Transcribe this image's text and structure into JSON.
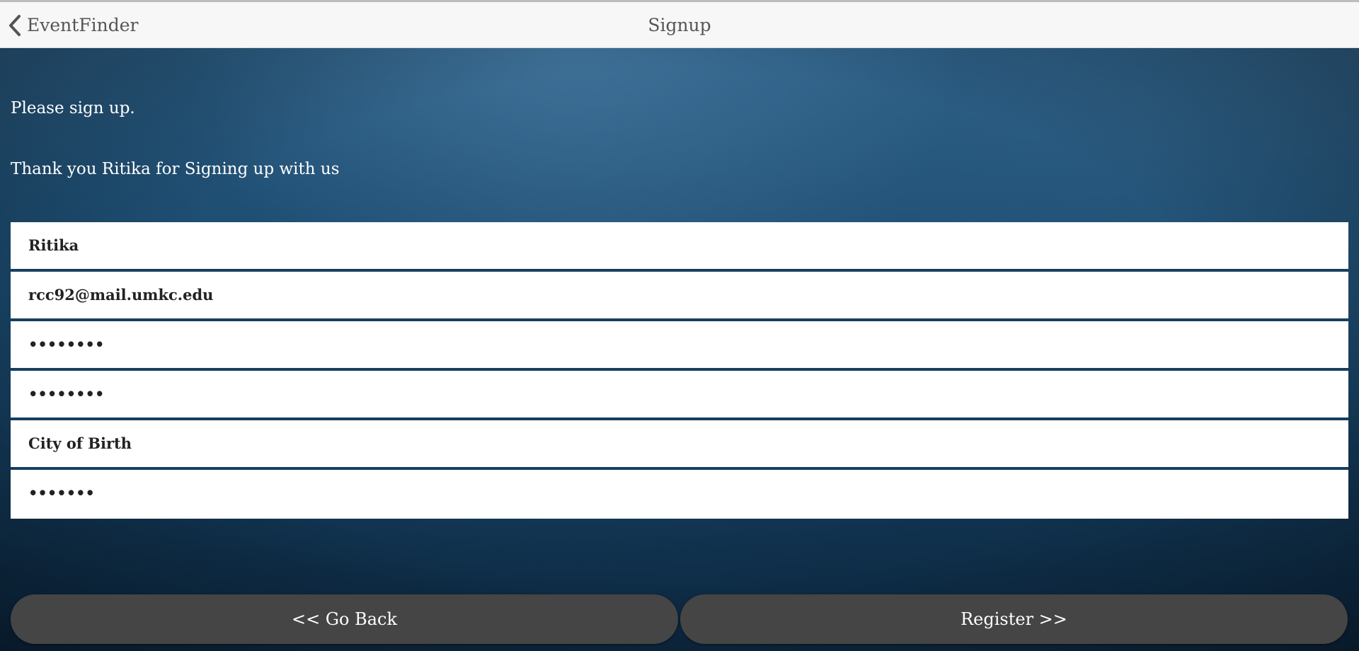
{
  "header": {
    "back_label": "EventFinder",
    "title": "Signup"
  },
  "messages": {
    "prompt": "Please sign up.",
    "thanks": "Thank you Ritika for Signing up with us"
  },
  "form": {
    "fields": [
      {
        "name": "name",
        "value": "Ritika",
        "type": "text"
      },
      {
        "name": "email",
        "value": "rcc92@mail.umkc.edu",
        "type": "email"
      },
      {
        "name": "password",
        "value": "••••••••",
        "type": "password"
      },
      {
        "name": "confirm-password",
        "value": "••••••••",
        "type": "password"
      },
      {
        "name": "city-of-birth",
        "value": "City of Birth",
        "type": "text"
      },
      {
        "name": "security-answer",
        "value": "•••••••",
        "type": "password"
      }
    ]
  },
  "buttons": {
    "go_back": "<< Go Back",
    "register": "Register >>"
  },
  "colors": {
    "header_bg": "#f7f7f7",
    "button_bg": "#454545",
    "background_primary": "#1d4c70"
  },
  "icons": {
    "back": "chevron-left-icon"
  }
}
